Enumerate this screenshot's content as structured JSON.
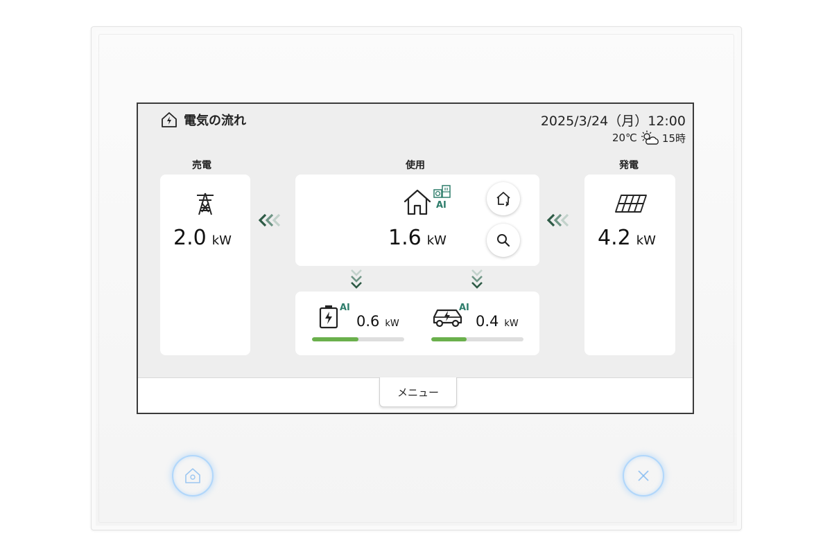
{
  "header": {
    "title": "電気の流れ",
    "datetime": "2025/3/24（月）12:00",
    "temperature": "20℃",
    "weather_icon": "partly-cloudy-icon",
    "forecast_hour": "15時"
  },
  "sell": {
    "label": "売電",
    "value": "2.0",
    "unit": "kW",
    "icon": "power-tower-icon"
  },
  "use": {
    "label": "使用",
    "value": "1.6",
    "unit": "kW",
    "icon": "house-icon",
    "ai": "AI"
  },
  "generation": {
    "label": "発電",
    "value": "4.2",
    "unit": "kW",
    "icon": "solar-panel-icon"
  },
  "battery": {
    "value": "0.6",
    "unit": "kW",
    "ai": "AI",
    "level_percent": 50
  },
  "ev": {
    "value": "0.4",
    "unit": "kW",
    "ai": "AI",
    "level_percent": 38
  },
  "menu": {
    "label": "メニュー"
  },
  "colors": {
    "accent_green": "#2e7d6b",
    "bar_green": "#6ab04c"
  }
}
